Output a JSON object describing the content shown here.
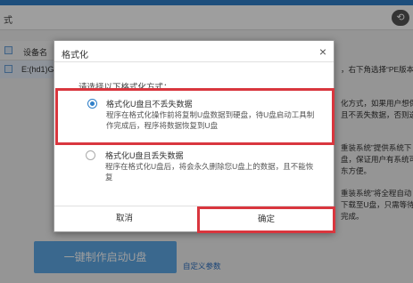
{
  "app": {
    "title_fragment": "式",
    "title_icon": "⟲",
    "table": {
      "column_device": "设备名",
      "row_device": "E:(hd1)Ge"
    },
    "right_texts": [
      "，右下角选择“PE版本”",
      "化方式，如果用户想保",
      "且不丢失数据，否则选",
      "重装系统”提供系统下",
      "盘，保证用户有系统可",
      "东方便。",
      "重装系统”将全程自动",
      "下载至U盘，只需等待",
      "完成。"
    ],
    "make_button": "一键制作启动U盘",
    "custom_params": "自定义参数",
    "accent_color": "#2f7fc8"
  },
  "dialog": {
    "title": "格式化",
    "close": "×",
    "prompt": "请选择以下格式化方式：",
    "option1": {
      "title": "格式化U盘且不丢失数据",
      "desc": "程序在格式化操作前将复制U盘数据到硬盘，待U盘启动工具制作完成后，程序将数据恢复到U盘",
      "selected": true
    },
    "option2": {
      "title": "格式化U盘且丢失数据",
      "desc": "程序在格式化U盘后，将会永久删除您U盘上的数据，且不能恢复",
      "selected": false
    },
    "cancel": "取消",
    "confirm": "确定",
    "highlight_color": "#d9363e"
  }
}
